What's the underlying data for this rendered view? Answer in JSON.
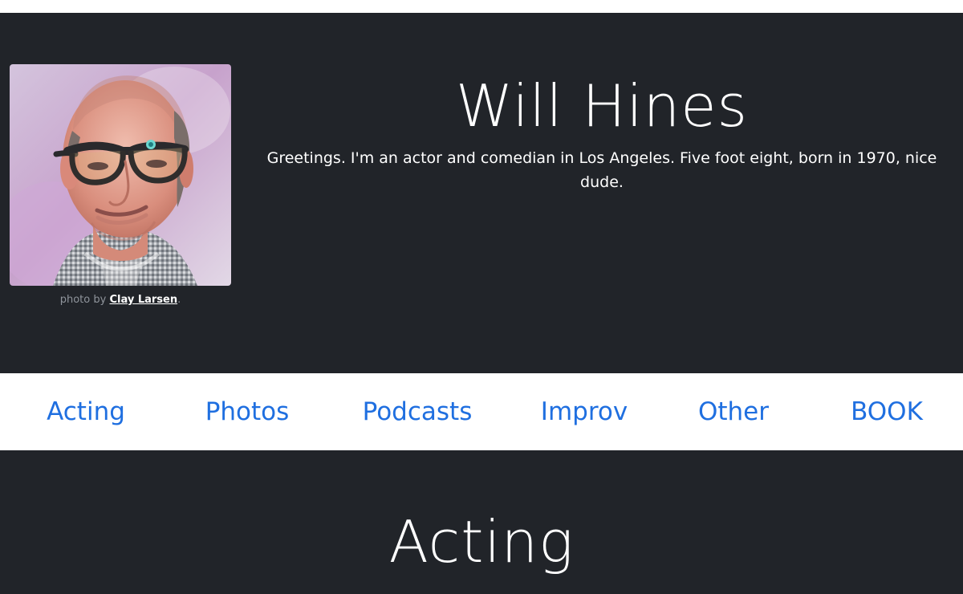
{
  "hero": {
    "title": "Will Hines",
    "intro": "Greetings. I'm an actor and comedian in Los Angeles. Five foot eight, born in 1970, nice dude.",
    "photo_credit_prefix": "photo by ",
    "photo_credit_name": "Clay Larsen",
    "photo_credit_suffix": "."
  },
  "nav": {
    "items": [
      "Acting",
      "Photos",
      "Podcasts",
      "Improv",
      "Other",
      "BOOK"
    ]
  },
  "section": {
    "title": "Acting"
  },
  "colors": {
    "background_dark": "#212429",
    "link_blue": "#1f6fe0",
    "text_light": "#ffffff",
    "credit_gray": "#8f949b"
  }
}
